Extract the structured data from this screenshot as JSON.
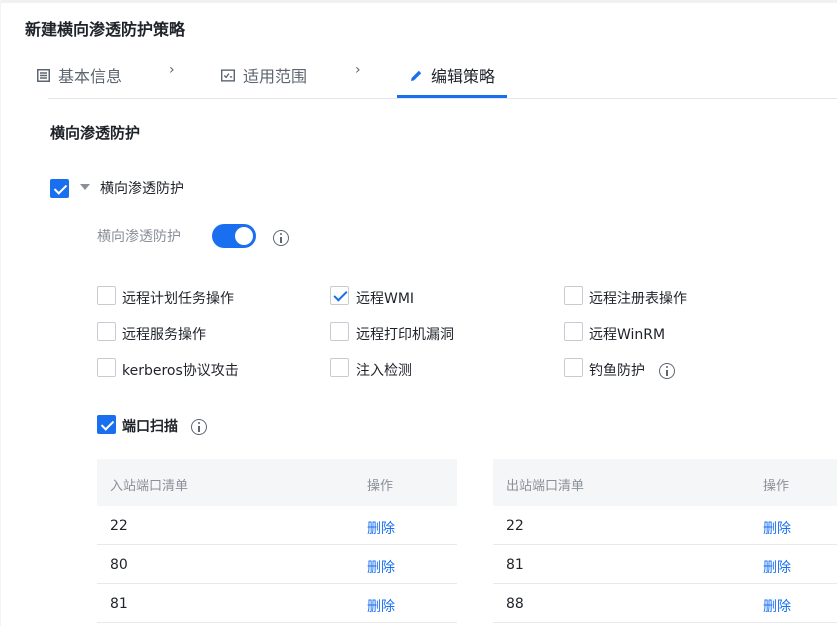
{
  "page": {
    "title": "新建横向渗透防护策略"
  },
  "steps": [
    {
      "label": "基本信息",
      "icon": "form-icon"
    },
    {
      "label": "适用范围",
      "icon": "scope-icon"
    },
    {
      "label": "编辑策略",
      "icon": "pencil-icon"
    }
  ],
  "separator": "›",
  "section": {
    "title": "横向渗透防护"
  },
  "group": {
    "label": "横向渗透防护",
    "checked": true,
    "toggle_label": "横向渗透防护",
    "toggle_on": true
  },
  "options": [
    {
      "label": "远程计划任务操作",
      "checked": false
    },
    {
      "label": "远程WMI",
      "checked": true
    },
    {
      "label": "远程注册表操作",
      "checked": false
    },
    {
      "label": "远程服务操作",
      "checked": false
    },
    {
      "label": "远程打印机漏洞",
      "checked": false
    },
    {
      "label": "远程WinRM",
      "checked": false
    },
    {
      "label": "kerberos协议攻击",
      "checked": false
    },
    {
      "label": "注入检测",
      "checked": false
    },
    {
      "label": "钓鱼防护",
      "checked": false
    }
  ],
  "port_scan": {
    "label": "端口扫描",
    "checked": true
  },
  "inbound": {
    "col_list": "入站端口清单",
    "col_action": "操作",
    "rows": [
      {
        "port": "22",
        "action": "删除"
      },
      {
        "port": "80",
        "action": "删除"
      },
      {
        "port": "81",
        "action": "删除"
      }
    ]
  },
  "outbound": {
    "col_list": "出站端口清单",
    "col_action": "操作",
    "rows": [
      {
        "port": "22",
        "action": "删除"
      },
      {
        "port": "81",
        "action": "删除"
      },
      {
        "port": "88",
        "action": "删除"
      }
    ]
  },
  "colors": {
    "accent": "#1a6ff0",
    "text": "#1f2329",
    "muted": "#8a9099"
  }
}
